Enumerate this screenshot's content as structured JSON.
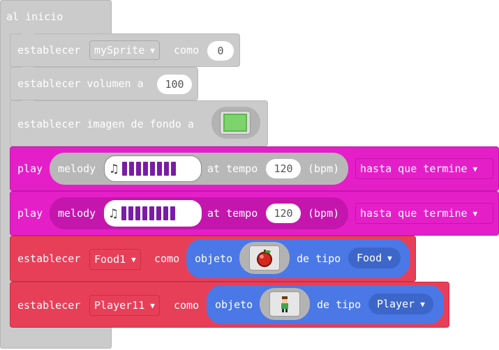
{
  "on_start": {
    "label": "al inicio"
  },
  "blocks": {
    "set_sprite": {
      "label1": "establecer",
      "variable": "mySprite",
      "label2": "como",
      "value": "0"
    },
    "set_volume": {
      "label": "establecer volumen a",
      "value": "100"
    },
    "set_background": {
      "label": "establecer imagen de fondo a"
    },
    "play1": {
      "play": "play",
      "melody": "melody",
      "at_tempo": "at tempo",
      "tempo": "120",
      "bpm": "(bpm)",
      "mode": "hasta que termine"
    },
    "play2": {
      "play": "play",
      "melody": "melody",
      "at_tempo": "at tempo",
      "tempo": "120",
      "bpm": "(bpm)",
      "mode": "hasta que termine"
    },
    "set_food": {
      "label1": "establecer",
      "variable": "Food1",
      "label2": "como",
      "object": "objeto",
      "of_type": "de tipo",
      "kind": "Food"
    },
    "set_player": {
      "label1": "establecer",
      "variable": "Player11",
      "label2": "como",
      "object": "objeto",
      "of_type": "de tipo",
      "kind": "Player"
    }
  },
  "colors": {
    "hat": "#cbcbcb",
    "music": "#e41fc8",
    "sprites": "#e83f58",
    "object": "#4a78e6"
  },
  "icons": [
    "chevron-down-icon",
    "music-note-icon",
    "apple-sprite-icon",
    "player-sprite-icon",
    "green-background-icon"
  ]
}
